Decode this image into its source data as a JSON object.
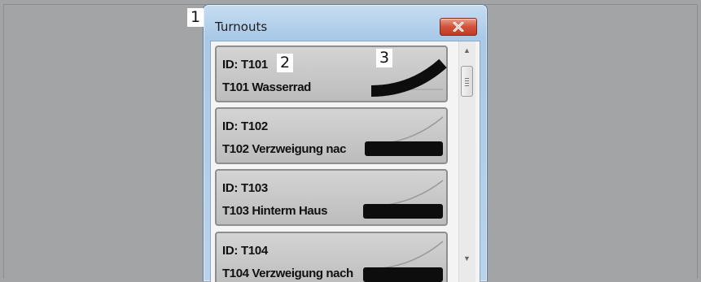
{
  "window": {
    "title": "Turnouts",
    "close_icon": "close-icon",
    "accent": "#d3513a"
  },
  "callouts": [
    "1",
    "2",
    "3"
  ],
  "turnouts": [
    {
      "id_label": "ID: T101",
      "name": "T101 Wasserrad",
      "icon": "turnout-curve-icon",
      "state": "active"
    },
    {
      "id_label": "ID: T102",
      "name": "T102 Verzweigung nac",
      "icon": "turnout-curve-icon",
      "state": "inactive"
    },
    {
      "id_label": "ID: T103",
      "name": "T103 Hinterm Haus",
      "icon": "turnout-curve-icon",
      "state": "inactive"
    },
    {
      "id_label": "ID: T104",
      "name": "T104 Verzweigung nach",
      "icon": "turnout-curve-icon",
      "state": "inactive"
    }
  ],
  "scrollbar": {
    "up_icon": "scroll-up-icon",
    "down_icon": "scroll-down-icon"
  }
}
